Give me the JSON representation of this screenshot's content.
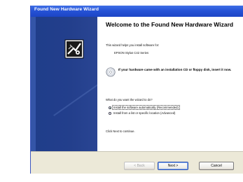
{
  "window": {
    "title": "Found New Hardware Wizard"
  },
  "side_panel": {
    "icon": "hardware-wizard-icon"
  },
  "content": {
    "heading": "Welcome to the Found New Hardware Wizard",
    "intro": "This wizard helps you install software for:",
    "device_name": "EPSON Stylus C42 Series",
    "cd_prompt": "If your hardware came with an installation CD or floppy disk, insert it now.",
    "question": "What do you want the wizard to do?",
    "options": [
      {
        "label": "Install the software automatically (Recommended)",
        "checked": true
      },
      {
        "label": "Install from a list or specific location (Advanced)",
        "checked": false
      }
    ],
    "continue_text": "Click Next to continue."
  },
  "buttons": {
    "back": "< Back",
    "next": "Next >",
    "cancel": "Cancel"
  },
  "colors": {
    "titlebar": "#2653d6",
    "side_panel": "#233f8c",
    "footer": "#ece9d8"
  }
}
